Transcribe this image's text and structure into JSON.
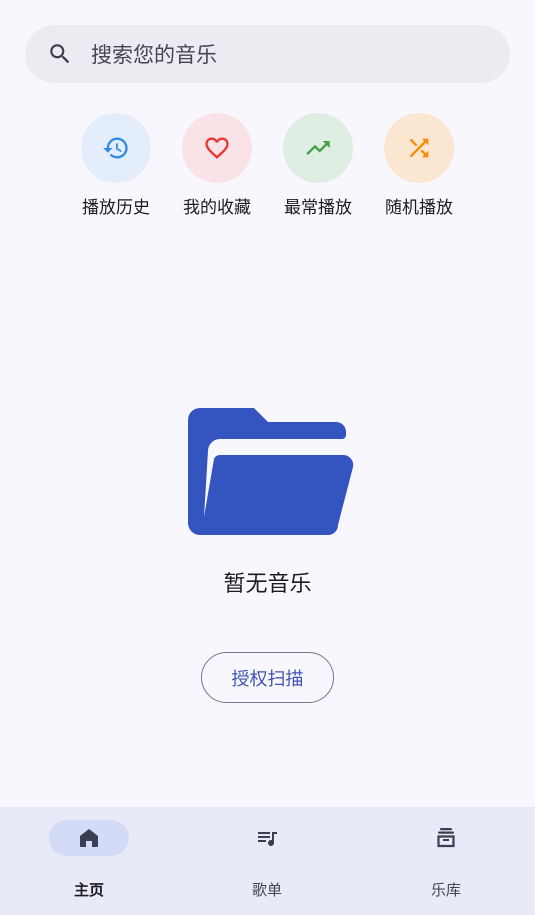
{
  "search": {
    "placeholder": "搜索您的音乐",
    "icon": "search-icon"
  },
  "quick_actions": [
    {
      "label": "播放历史",
      "icon": "history-icon",
      "bg": "#e3edfc",
      "color": "#2f8be6"
    },
    {
      "label": "我的收藏",
      "icon": "heart-icon",
      "bg": "#fae3e6",
      "color": "#e53935"
    },
    {
      "label": "最常播放",
      "icon": "trending-up-icon",
      "bg": "#dfeee2",
      "color": "#43a047"
    },
    {
      "label": "随机播放",
      "icon": "shuffle-icon",
      "bg": "#fbe6d2",
      "color": "#fb8c00"
    }
  ],
  "empty_state": {
    "icon": "folder-open-icon",
    "icon_color": "#3454c0",
    "message": "暂无音乐",
    "button_label": "授权扫描"
  },
  "bottom_nav": {
    "active": 0,
    "items": [
      {
        "label": "主页",
        "icon": "home-icon"
      },
      {
        "label": "歌单",
        "icon": "playlist-icon"
      },
      {
        "label": "乐库",
        "icon": "library-icon"
      }
    ]
  }
}
